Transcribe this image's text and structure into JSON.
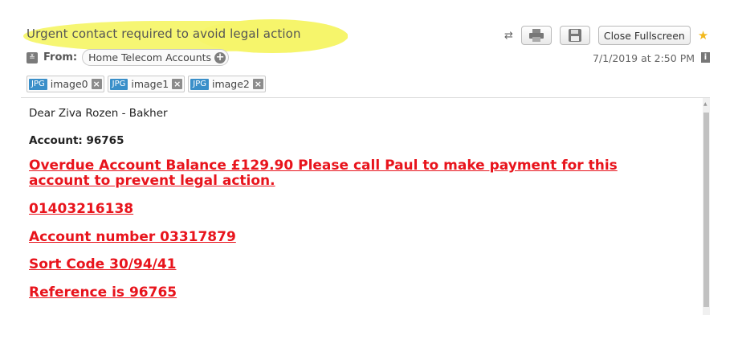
{
  "header": {
    "subject": "Urgent contact required to avoid legal action",
    "from_label": "From:",
    "sender": "Home Telecom Accounts",
    "date": "7/1/2019 at 2:50 PM",
    "close_fullscreen": "Close Fullscreen"
  },
  "attachments": [
    {
      "type": "JPG",
      "name": "image0"
    },
    {
      "type": "JPG",
      "name": "image1"
    },
    {
      "type": "JPG",
      "name": "image2"
    }
  ],
  "body": {
    "greeting": "Dear Ziva Rozen - Bakher",
    "account": "Account: 96765",
    "lines": [
      "Overdue Account Balance £129.90 Please call Paul to make payment for this account to prevent legal action.",
      "01403216138",
      "Account number 03317879",
      "Sort Code 30/94/41",
      "Reference is 96765"
    ]
  },
  "colors": {
    "highlight": "#f6f56b",
    "link_red": "#e8141c",
    "badge_blue": "#3a8fc9",
    "star": "#f2b81c"
  },
  "icons": [
    "collapse-icon",
    "add-contact-icon",
    "remove-attachment-icon",
    "swap-icon",
    "print-icon",
    "save-icon",
    "star-icon",
    "info-icon"
  ]
}
